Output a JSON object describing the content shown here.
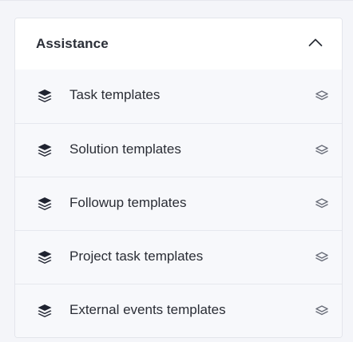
{
  "panel": {
    "title": "Assistance",
    "collapse_icon": "chevron-up-icon"
  },
  "items": [
    {
      "label": "Task templates",
      "icon": "layers-filled-icon",
      "action_icon": "layers-outline-icon"
    },
    {
      "label": "Solution templates",
      "icon": "layers-filled-icon",
      "action_icon": "layers-outline-icon"
    },
    {
      "label": "Followup templates",
      "icon": "layers-filled-icon",
      "action_icon": "layers-outline-icon"
    },
    {
      "label": "Project task templates",
      "icon": "layers-filled-icon",
      "action_icon": "layers-outline-icon"
    },
    {
      "label": "External events templates",
      "icon": "layers-filled-icon",
      "action_icon": "layers-outline-icon"
    }
  ],
  "colors": {
    "background": "#f4f5f9",
    "card": "#ffffff",
    "item_background": "#f7f8fb",
    "text": "#2a2d35",
    "icon": "#1f2330",
    "muted_icon": "#6b6f7a",
    "divider": "#e6e8ee"
  }
}
